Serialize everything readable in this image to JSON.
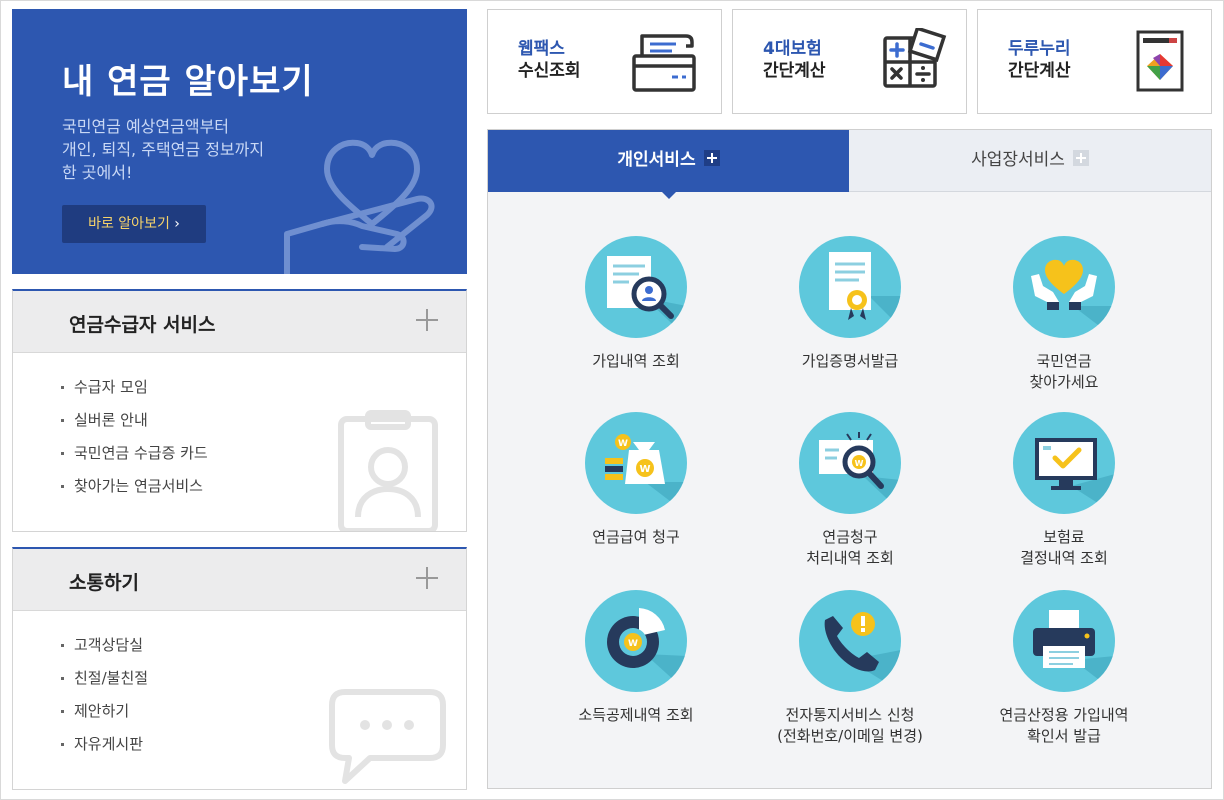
{
  "hero": {
    "title": "내 연금 알아보기",
    "desc_line1": "국민연금 예상연금액부터",
    "desc_line2": "개인, 퇴직, 주택연금 정보까지",
    "desc_line3": "한 곳에서!",
    "button_label": "바로 알아보기"
  },
  "pension_panel": {
    "title": "연금수급자 서비스",
    "items": [
      "수급자 모임",
      "실버론 안내",
      "국민연금 수급증 카드",
      "찾아가는 연금서비스"
    ]
  },
  "comm_panel": {
    "title": "소통하기",
    "items": [
      "고객상담실",
      "친절/불친절",
      "제안하기",
      "자유게시판"
    ]
  },
  "quick": [
    {
      "line1": "웹팩스",
      "line2": "수신조회",
      "icon": "fax-icon"
    },
    {
      "line1": "4대보험",
      "line2": "간단계산",
      "icon": "calculator-icon"
    },
    {
      "line1": "두루누리",
      "line2": "간단계산",
      "icon": "durunuri-icon"
    }
  ],
  "tabs": {
    "personal": "개인서비스",
    "business": "사업장서비스"
  },
  "services": [
    {
      "l1": "가입내역 조회",
      "l2": "",
      "icon": "document-search-icon"
    },
    {
      "l1": "가입증명서발급",
      "l2": "",
      "icon": "certificate-icon"
    },
    {
      "l1": "국민연금",
      "l2": "찾아가세요",
      "icon": "heart-hands-icon"
    },
    {
      "l1": "연금급여 청구",
      "l2": "",
      "icon": "money-bag-icon"
    },
    {
      "l1": "연금청구",
      "l2": "처리내역 조회",
      "icon": "receipt-search-icon"
    },
    {
      "l1": "보험료",
      "l2": "결정내역 조회",
      "icon": "monitor-check-icon"
    },
    {
      "l1": "소득공제내역 조회",
      "l2": "",
      "icon": "pie-chart-icon"
    },
    {
      "l1": "전자통지서비스 신청",
      "l2": "(전화번호/이메일 변경)",
      "icon": "phone-alert-icon"
    },
    {
      "l1": "연금산정용 가입내역",
      "l2": "확인서 발급",
      "icon": "printer-icon"
    }
  ],
  "colors": {
    "primary": "#2d57b0",
    "accent_yellow": "#f6d36a",
    "icon_circle": "#5ec8dc"
  }
}
